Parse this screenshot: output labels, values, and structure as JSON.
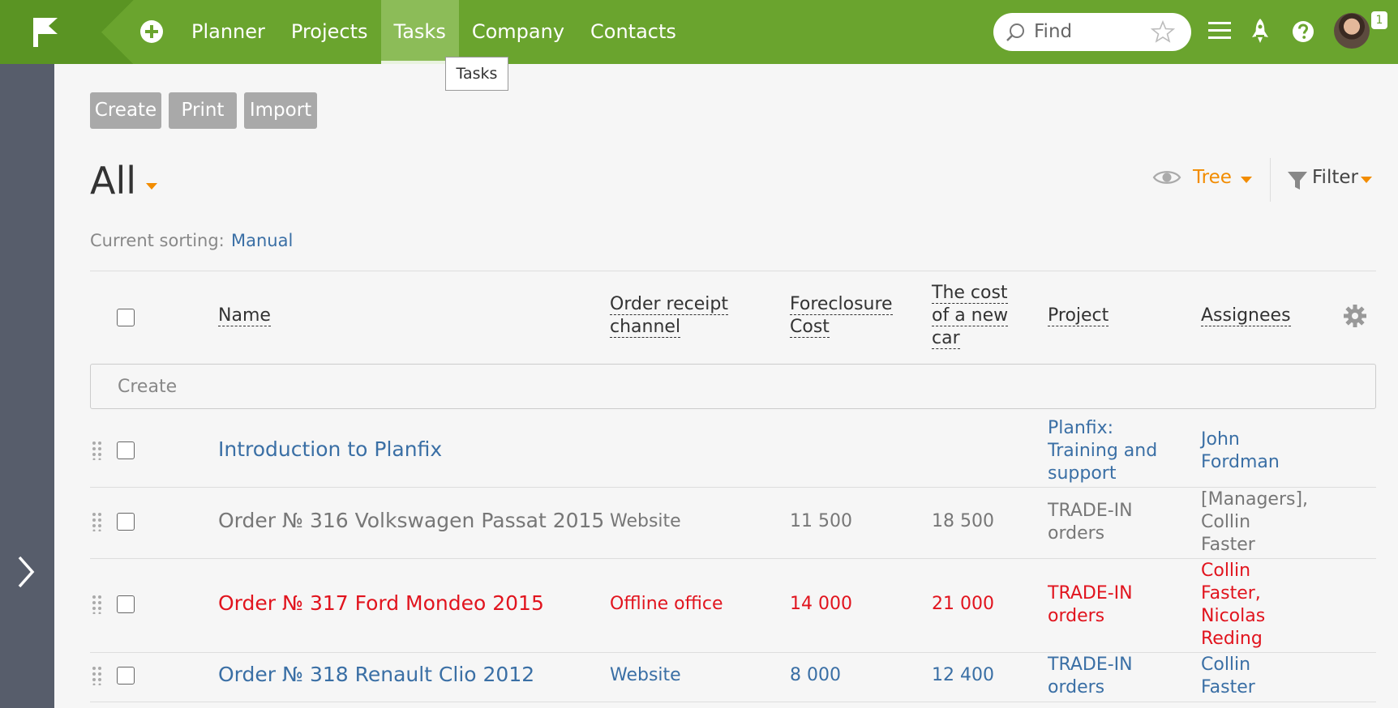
{
  "nav": {
    "items": [
      "Planner",
      "Projects",
      "Tasks",
      "Company",
      "Contacts"
    ],
    "active_tooltip": "Tasks"
  },
  "search": {
    "placeholder": "Find"
  },
  "user": {
    "notification_count": "1"
  },
  "toolbar": {
    "create": "Create",
    "print": "Print",
    "import": "Import"
  },
  "view": {
    "title": "All",
    "mode": "Tree",
    "filter": "Filter"
  },
  "sorting": {
    "label": "Current sorting:",
    "value": "Manual"
  },
  "table": {
    "headers": {
      "name": "Name",
      "channel_1": "Order receipt",
      "channel_2": "channel",
      "foreclosure_1": "Foreclosure",
      "foreclosure_2": "Cost",
      "newcar_1": "The cost",
      "newcar_2": "of a new",
      "newcar_3": "car",
      "project": "Project",
      "assignees": "Assignees"
    },
    "create_placeholder": "Create",
    "rows": [
      {
        "name": "Introduction to Planfix",
        "channel": "",
        "foreclosure": "",
        "newcar": "",
        "project": [
          "Planfix:",
          "Training and",
          "support"
        ],
        "assignees": [
          "John",
          "Fordman"
        ],
        "color": "blue"
      },
      {
        "name": "Order № 316 Volkswagen Passat 2015",
        "channel": "Website",
        "foreclosure": "11 500",
        "newcar": "18 500",
        "project": [
          "TRADE-IN",
          "orders"
        ],
        "assignees": [
          "[Managers],",
          "Collin",
          "Faster"
        ],
        "color": "gray"
      },
      {
        "name": "Order № 317 Ford Mondeo 2015",
        "channel": "Offline office",
        "foreclosure": "14 000",
        "newcar": "21 000",
        "project": [
          "TRADE-IN",
          "orders"
        ],
        "assignees": [
          "Collin",
          "Faster,",
          "Nicolas",
          "Reding"
        ],
        "color": "red"
      },
      {
        "name": "Order № 318 Renault Clio 2012",
        "channel": "Website",
        "foreclosure": "8 000",
        "newcar": "12 400",
        "project": [
          "TRADE-IN",
          "orders"
        ],
        "assignees": [
          "Collin",
          "Faster"
        ],
        "color": "blue"
      }
    ]
  }
}
